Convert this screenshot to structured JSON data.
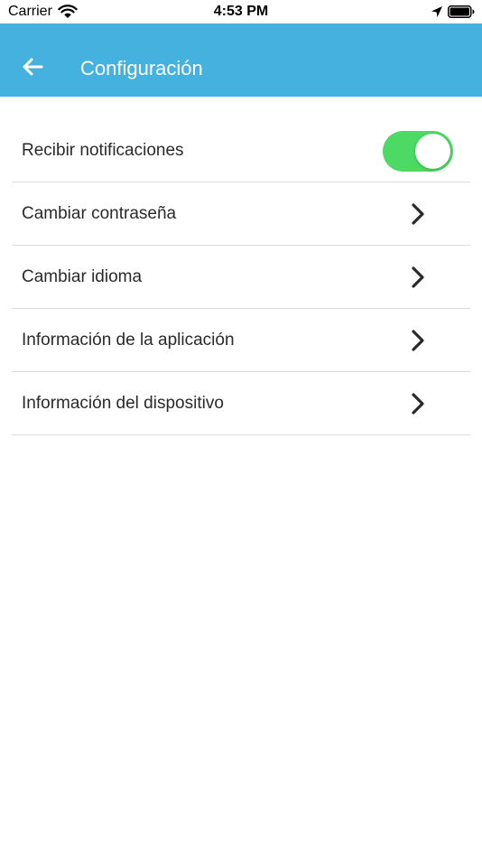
{
  "status_bar": {
    "carrier": "Carrier",
    "time": "4:53 PM",
    "wifi_icon": "wifi-icon",
    "location_icon": "location-arrow-icon",
    "battery_icon": "battery-full-icon"
  },
  "app_bar": {
    "title": "Configuración",
    "background_color": "#45b1de",
    "back_icon": "arrow-left-icon"
  },
  "settings": {
    "notifications": {
      "label": "Recibir notificaciones",
      "enabled": true,
      "toggle_color": "#4cd964"
    },
    "items": [
      {
        "label": "Cambiar contraseña",
        "icon": "chevron-right-icon"
      },
      {
        "label": "Cambiar idioma",
        "icon": "chevron-right-icon"
      },
      {
        "label": "Información de la aplicación",
        "icon": "chevron-right-icon"
      },
      {
        "label": "Información del dispositivo",
        "icon": "chevron-right-icon"
      }
    ]
  }
}
